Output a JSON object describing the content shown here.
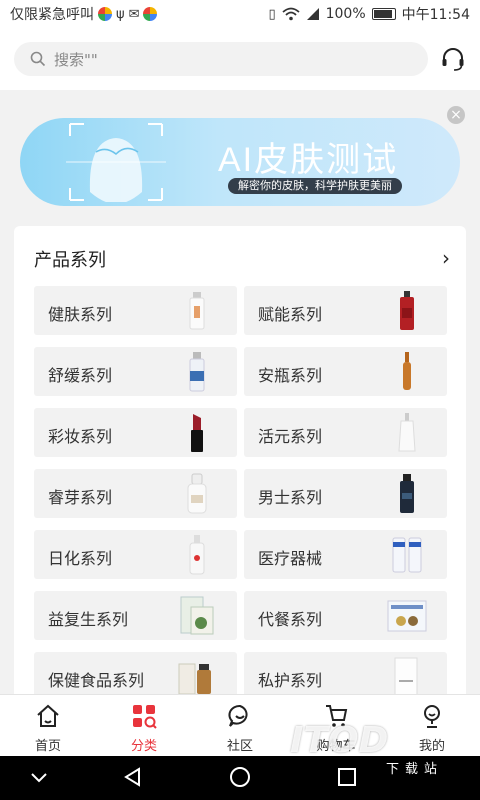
{
  "statusbar": {
    "left_text": "仅限紧急呼叫",
    "battery": "100%",
    "time": "中午11:54"
  },
  "search": {
    "placeholder": "搜索\"\""
  },
  "banner": {
    "title": "AI皮肤测试",
    "subtitle": "解密你的皮肤，科学护肤更美丽"
  },
  "card": {
    "title": "产品系列",
    "items": [
      {
        "label": "健肤系列"
      },
      {
        "label": "赋能系列"
      },
      {
        "label": "舒缓系列"
      },
      {
        "label": "安瓶系列"
      },
      {
        "label": "彩妆系列"
      },
      {
        "label": "活元系列"
      },
      {
        "label": "睿芽系列"
      },
      {
        "label": "男士系列"
      },
      {
        "label": "日化系列"
      },
      {
        "label": "医疗器械"
      },
      {
        "label": "益复生系列"
      },
      {
        "label": "代餐系列"
      },
      {
        "label": "保健食品系列"
      },
      {
        "label": "私护系列"
      }
    ]
  },
  "tabs": [
    {
      "label": "首页",
      "icon": "home-icon"
    },
    {
      "label": "分类",
      "icon": "category-icon",
      "active": true
    },
    {
      "label": "社区",
      "icon": "community-icon"
    },
    {
      "label": "购物车",
      "icon": "cart-icon"
    },
    {
      "label": "我的",
      "icon": "profile-icon"
    }
  ],
  "watermark": {
    "text": "ITOD",
    "sub": "下载站"
  },
  "colors": {
    "accent": "#e8343c",
    "banner": "#8fd6f5"
  }
}
